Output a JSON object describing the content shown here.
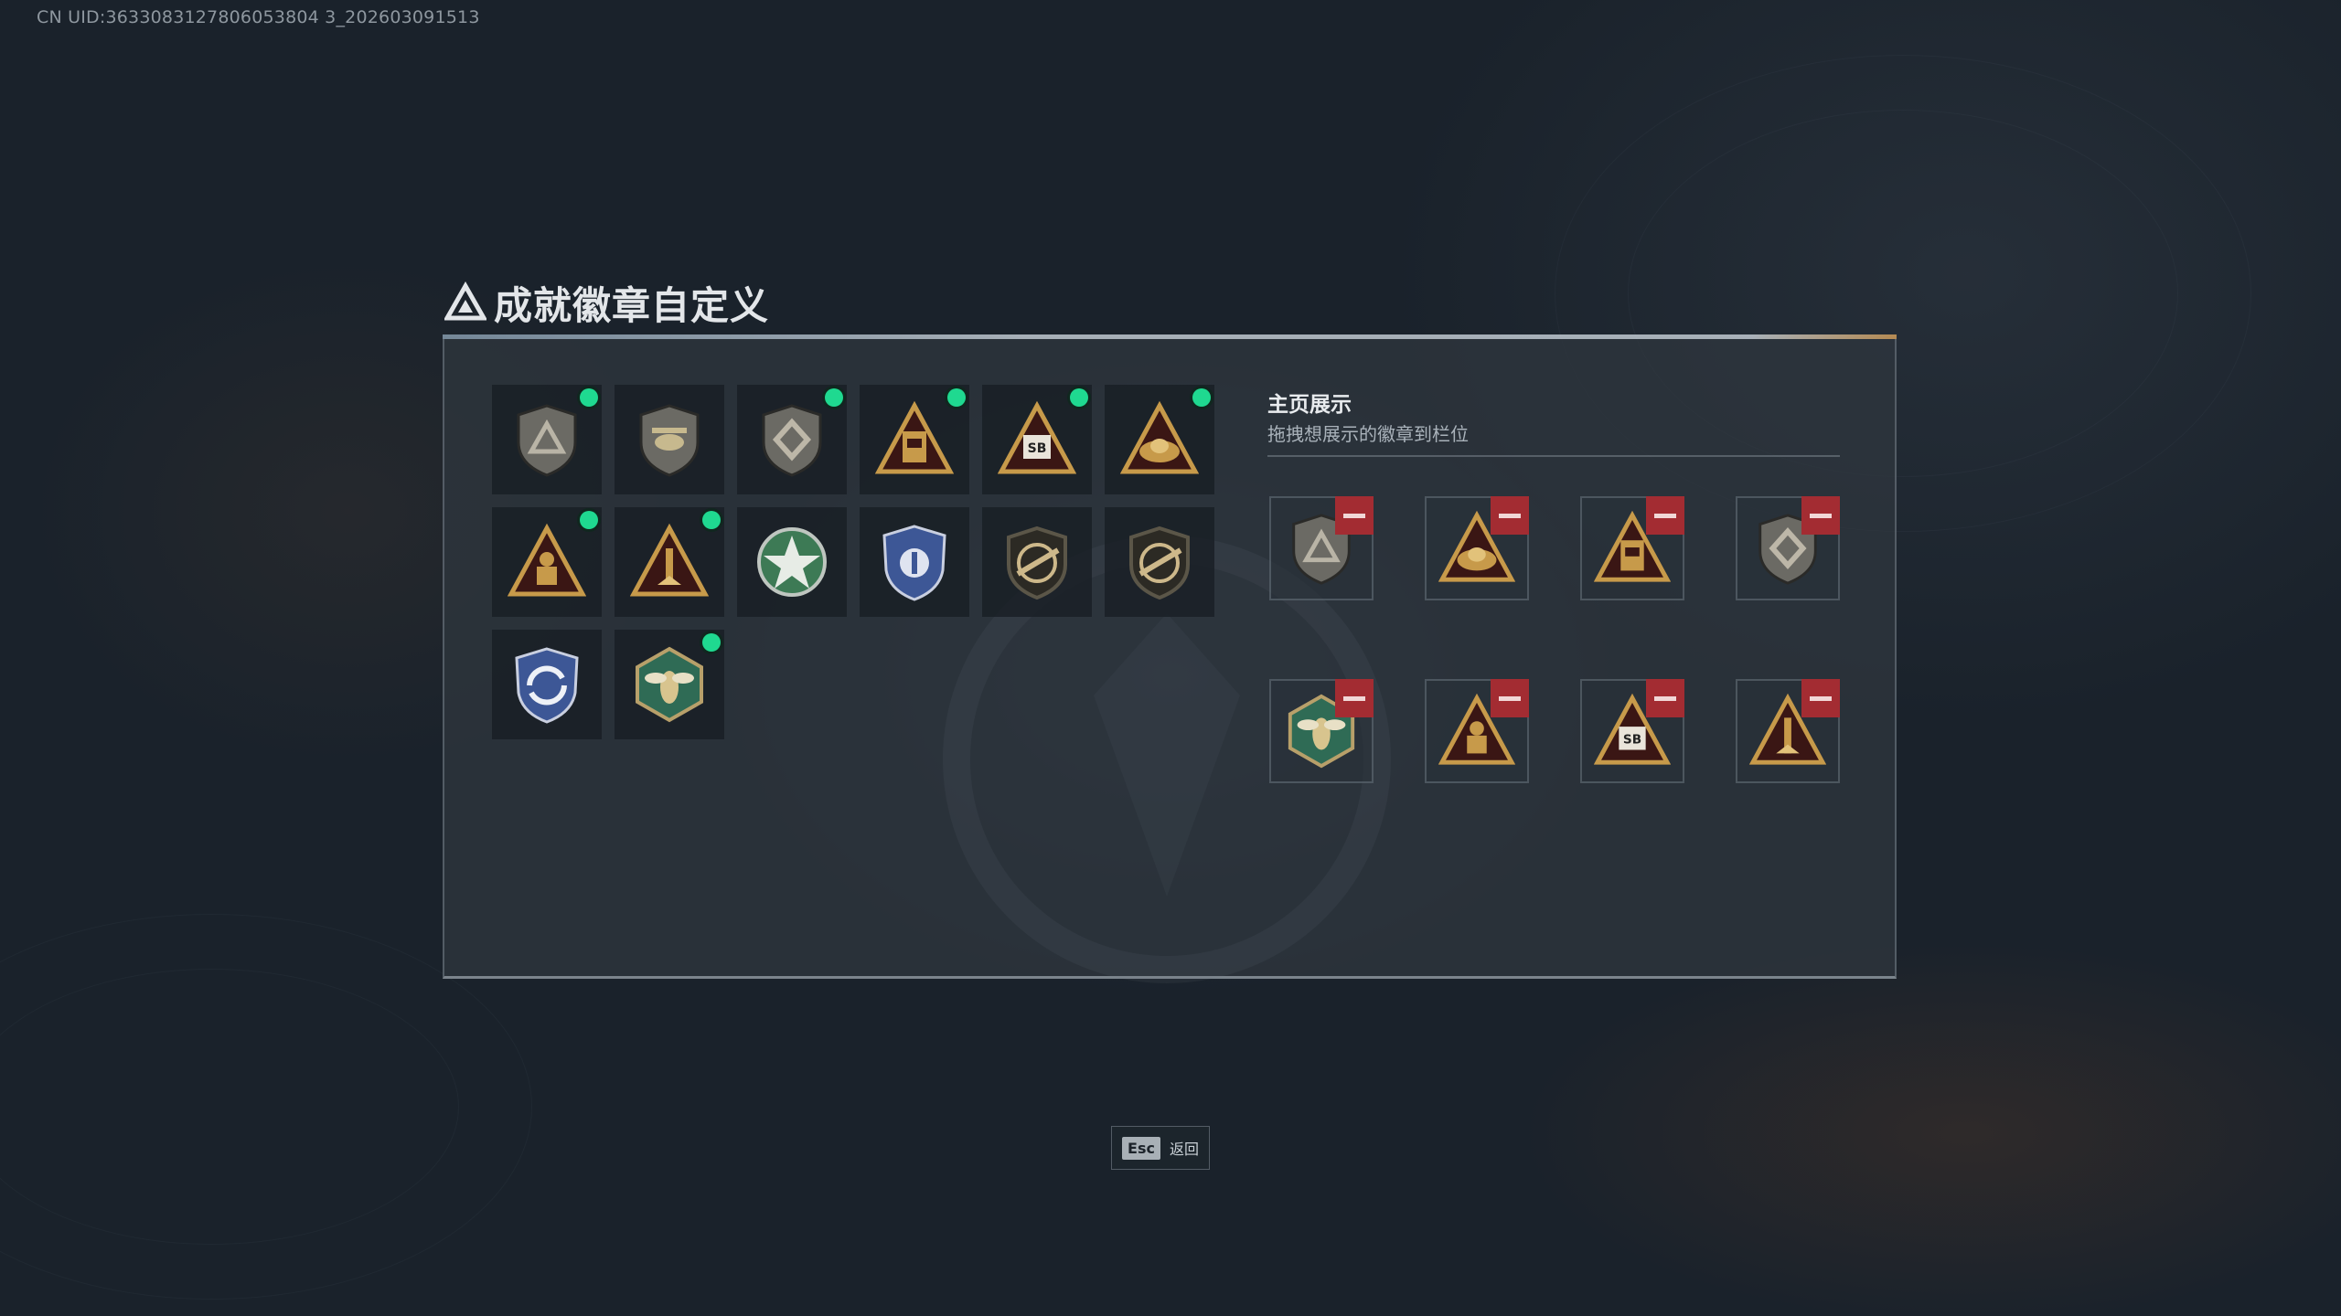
{
  "uid_text": "CN UID:3633083127806053804 3_202603091513",
  "header": {
    "title": "成就徽章自定义",
    "icon": "triangle-emblem-icon"
  },
  "collection": {
    "badges": [
      {
        "name": "shield-triangle-badge",
        "color": "#6b6a64",
        "is_new": true
      },
      {
        "name": "helicopter-shield-badge",
        "color": "#6b6a64",
        "is_new": false
      },
      {
        "name": "diamond-shield-badge",
        "color": "#6b6a64",
        "is_new": true
      },
      {
        "name": "gold-tower-triangle-badge",
        "color": "#c79a4a",
        "is_new": true
      },
      {
        "name": "sb-triangle-badge",
        "color": "#c79a4a",
        "is_new": true
      },
      {
        "name": "gold-helmet-triangle-badge",
        "color": "#c79a4a",
        "is_new": true
      },
      {
        "name": "gold-soldier-triangle-badge",
        "color": "#c79a4a",
        "is_new": true
      },
      {
        "name": "gold-rocket-triangle-badge",
        "color": "#c79a4a",
        "is_new": true
      },
      {
        "name": "green-star-badge",
        "color": "#3d7a55",
        "is_new": false
      },
      {
        "name": "blue-police-badge",
        "color": "#3d5796",
        "is_new": false
      },
      {
        "name": "rifle-shield-badge",
        "color": "#5b5648",
        "is_new": false
      },
      {
        "name": "rifle-shield-dark-badge",
        "color": "#5b5648",
        "is_new": false
      },
      {
        "name": "blue-arrows-shield-badge",
        "color": "#3d5796",
        "is_new": false
      },
      {
        "name": "green-wasp-hex-badge",
        "color": "#2f6b55",
        "is_new": true
      }
    ]
  },
  "showcase": {
    "title": "主页展示",
    "subtitle": "拖拽想展示的徽章到栏位",
    "slots": [
      {
        "badge": "shield-triangle-badge"
      },
      {
        "badge": "gold-helmet-triangle-badge"
      },
      {
        "badge": "gold-tower-triangle-badge"
      },
      {
        "badge": "diamond-shield-badge"
      },
      {
        "badge": "green-wasp-hex-badge"
      },
      {
        "badge": "gold-soldier-triangle-badge"
      },
      {
        "badge": "sb-triangle-badge"
      },
      {
        "badge": "gold-rocket-triangle-badge"
      }
    ]
  },
  "footer": {
    "esc_key": "Esc",
    "esc_label": "返回"
  },
  "colors": {
    "new_dot": "#1fd990",
    "remove": "#a32c32",
    "accent": "#d8a15a"
  }
}
